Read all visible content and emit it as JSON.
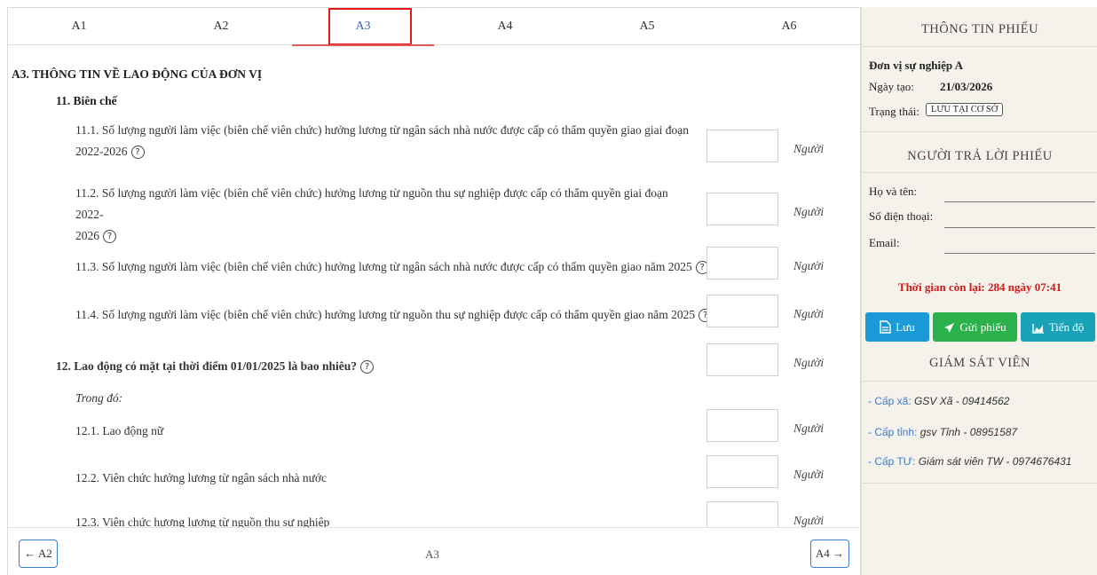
{
  "tabs": [
    {
      "label": "A1"
    },
    {
      "label": "A2"
    },
    {
      "label": "A3"
    },
    {
      "label": "A4"
    },
    {
      "label": "A5"
    },
    {
      "label": "A6"
    }
  ],
  "section": {
    "title": "A3. THÔNG TIN VỀ LAO ĐỘNG CỦA ĐƠN VỊ",
    "group_11": "11. Biên chế",
    "q11_1": "11.1. Số lượng người làm việc (biên chế viên chức) hưởng lương từ ngân sách nhà nước được cấp có thẩm quyền giao giai đoạn",
    "q11_1_b": "2022-2026",
    "q11_2": "11.2. Số lượng người làm việc (biên chế viên chức) hưởng lương từ nguồn thu sự nghiệp được cấp có thẩm quyền giai đoạn 2022-",
    "q11_2_b": "2026",
    "q11_3": "11.3. Số lượng người làm việc (biên chế viên chức) hưởng lương từ ngân sách nhà nước được cấp có thẩm quyền giao năm 2025",
    "q11_4": "11.4. Số lượng người làm việc (biên chế viên chức) hưởng lương từ nguồn thu sự nghiệp được cấp có thẩm quyền giao năm 2025",
    "q12": "12. Lao động có mặt tại thời điểm 01/01/2025 là bao nhiêu?",
    "q12_note": "Trong đó:",
    "q12_1": "12.1. Lao động nữ",
    "q12_2": "12.2. Viên chức hưởng lương từ ngân sách nhà nước",
    "q12_3": "12.3. Viên chức hương lương từ nguồn thu sự nghiệp",
    "unit": "Người",
    "help": "?"
  },
  "footer": {
    "prev": "← A2",
    "current": "A3",
    "next": "A4 →"
  },
  "sidebar": {
    "info_title": "THÔNG TIN PHIẾU",
    "unit_name": "Đơn vị sự nghiệp A",
    "created_label": "Ngày tạo:",
    "created_value": "21/03/2026",
    "status_label": "Trạng thái:",
    "status_value": "LƯU TẠI CƠ SỞ",
    "respondent_title": "NGƯỜI TRẢ LỜI PHIẾU",
    "name_label": "Họ và tên:",
    "phone_label": "Số điện thoại:",
    "email_label": "Email:",
    "countdown": "Thời gian còn lại: 284 ngày 07:41",
    "save_label": "Lưu",
    "send_label": "Gửi phiếu",
    "progress_label": "Tiến độ",
    "supervisor_title": "GIÁM SÁT VIÊN",
    "supervisors": [
      {
        "level": "- Cấp xã:",
        "value": "GSV Xã - 09414562"
      },
      {
        "level": "- Cấp tỉnh:",
        "value": "gsv Tỉnh - 08951587"
      },
      {
        "level": "- Cấp TƯ:",
        "value": "Giám sát viên TW - 0974676431"
      }
    ]
  },
  "colors": {
    "active_tab_box": "#e1191b",
    "save_btn": "#1a9bd7",
    "send_btn": "#2ab14b",
    "progress_btn": "#1aa3b8",
    "countdown": "#d31b1b",
    "supervisor_level": "#3a7bd5"
  }
}
